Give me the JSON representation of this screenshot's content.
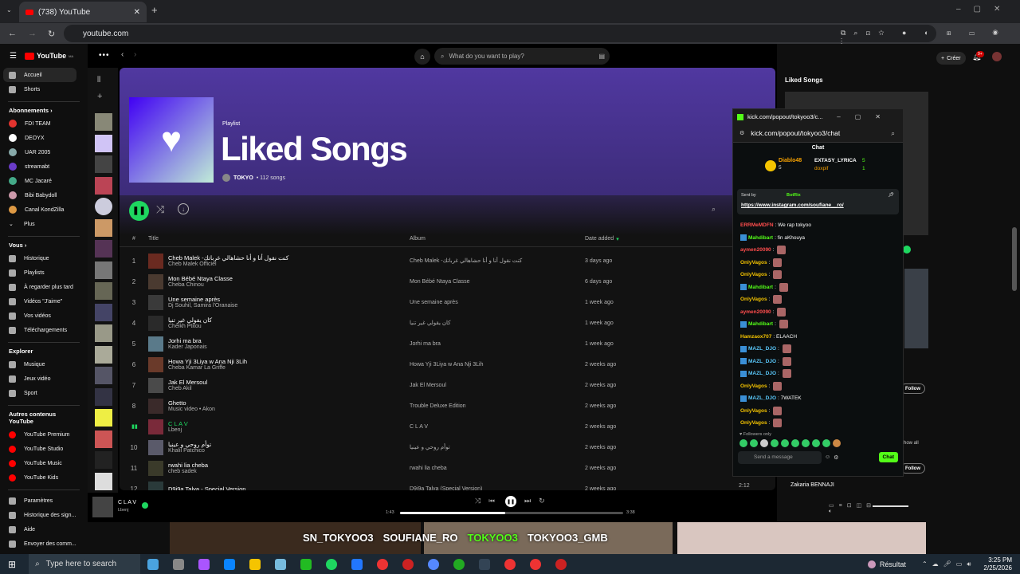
{
  "browser": {
    "tab_title": "(738) YouTube",
    "url": "youtube.com"
  },
  "youtube": {
    "logo": "YouTube",
    "country": "MA",
    "top": [
      "Accueil",
      "Shorts"
    ],
    "subs_title": "Abonnements",
    "subs": [
      "FDI TEAM",
      "DEOYX",
      "UAR 2005",
      "streamabt",
      "MC Jacaré",
      "Bibi Babydoll",
      "Canal KondZilla",
      "Plus"
    ],
    "you_title": "Vous",
    "you": [
      "Historique",
      "Playlists",
      "À regarder plus tard",
      "Vidéos \"J'aime\"",
      "Vos vidéos",
      "Téléchargements"
    ],
    "explore_title": "Explorer",
    "explore": [
      "Musique",
      "Jeux vidéo",
      "Sport"
    ],
    "other_title": "Autres contenus YouTube",
    "other": [
      "YouTube Premium",
      "YouTube Studio",
      "YouTube Music",
      "YouTube Kids"
    ],
    "bottom": [
      "Paramètres",
      "Historique des sign...",
      "Aide",
      "Envoyer des comm..."
    ],
    "create": "Créer",
    "notif": "9+",
    "right_title": "Liked Songs",
    "follow": "Follow",
    "see_all": "Show all",
    "artist": "Zakaria BENNAJI"
  },
  "spotify": {
    "search_placeholder": "What do you want to play?",
    "type": "Playlist",
    "title": "Liked Songs",
    "owner": "TOKYO",
    "meta": "• 112 songs",
    "headers": {
      "num": "#",
      "title": "Title",
      "album": "Album",
      "date": "Date added"
    },
    "tracks": [
      {
        "n": "1",
        "title": "Cheb Malek -كنت نقول أنا و أنا حشاهالي غرباتك",
        "artist": "Cheb Malek Officiel",
        "album": "Cheb Malek -كنت نقول أنا و أنا حشاهالي غرباتك",
        "date": "3 days ago"
      },
      {
        "n": "2",
        "title": "Mon Bébé Ntaya Classe",
        "artist": "Cheba Chinou",
        "album": "Mon Bébé Ntaya Classe",
        "date": "6 days ago"
      },
      {
        "n": "3",
        "title": "Une semaine après",
        "artist": "Dj Souhil, Samira l'Oranaise",
        "album": "Une semaine après",
        "date": "1 week ago"
      },
      {
        "n": "4",
        "title": "كان يقولي غير تنيا",
        "artist": "Cheikh Ptitou",
        "album": "كان يقولي غير تنيا",
        "date": "1 week ago"
      },
      {
        "n": "5",
        "title": "Jorhi ma bra",
        "artist": "Kader Japonais",
        "album": "Jorhi ma bra",
        "date": "1 week ago"
      },
      {
        "n": "6",
        "title": "Howa Yji 3Liya w Ana Nji 3Lih",
        "artist": "Cheba Kamar La Griffe",
        "album": "Howa Yji 3Liya w Ana Nji 3Lih",
        "date": "2 weeks ago"
      },
      {
        "n": "7",
        "title": "Jak El Mersoul",
        "artist": "Cheb Akil",
        "album": "Jak El Mersoul",
        "date": "2 weeks ago"
      },
      {
        "n": "8",
        "title": "Ghetto",
        "artist": "Music video • Akon",
        "album": "Trouble Deluxe Edition",
        "date": "2 weeks ago"
      },
      {
        "n": "",
        "title": "C L A V",
        "artist": "Lbenj",
        "album": "C L A V",
        "date": "2 weeks ago"
      },
      {
        "n": "10",
        "title": "توأم روحي و عينيا",
        "artist": "Khalil Patchico",
        "album": "توأم روحي و عينيا",
        "date": "2 weeks ago"
      },
      {
        "n": "11",
        "title": "rwahi lia cheba",
        "artist": "cheb sadek",
        "album": "rwahi lia cheba",
        "date": "2 weeks ago"
      },
      {
        "n": "12",
        "title": "D9i9a Talya - Special Version",
        "artist": "",
        "album": "D9i9a Talya (Special Version)",
        "date": "2 weeks ago"
      }
    ],
    "now_title": "C L A V",
    "now_artist": "Lbenj",
    "time_cur": "1:43",
    "time_total": "3:38",
    "progress": 0.47,
    "side_time": "2:12"
  },
  "kick": {
    "title": "kick.com/popout/tokyoo3/c...",
    "url": "kick.com/popout/tokyoo3/chat",
    "chat_label": "Chat",
    "gifters": [
      {
        "name": "Diablo48",
        "count": "5"
      },
      {
        "name": "EXTASY_LYRICA",
        "count": "5"
      },
      {
        "name": "doxpif",
        "count": "1"
      }
    ],
    "pinned_by": "Sent by",
    "pinned_user": "BotRix",
    "pinned_link": "https://www.instagram.com/soufiane__ro/",
    "messages": [
      {
        "user": "ERRMeMDFN",
        "text": ": We rap tokyoo",
        "color": "#ff4d4d"
      },
      {
        "user": "Mahdibart",
        "text": ": fin aKhouya",
        "color": "#53fc18"
      },
      {
        "user": "aymen20090",
        "text": ":",
        "color": "#ff4d4d"
      },
      {
        "user": "OnlyVagos",
        "text": ":",
        "color": "#f5c400"
      },
      {
        "user": "OnlyVagos",
        "text": ":",
        "color": "#f5c400"
      },
      {
        "user": "Mahdibart",
        "text": ":",
        "color": "#53fc18"
      },
      {
        "user": "OnlyVagos",
        "text": ":",
        "color": "#f5c400"
      },
      {
        "user": "aymen20090",
        "text": ":",
        "color": "#ff4d4d"
      },
      {
        "user": "Mahdibart",
        "text": ":",
        "color": "#53fc18"
      },
      {
        "user": "Hamzaox707",
        "text": ": ELAACH",
        "color": "#f5c400"
      },
      {
        "user": "MAZL_DJO",
        "text": ":",
        "color": "#5ac8fa"
      },
      {
        "user": "MAZL_DJO",
        "text": ":",
        "color": "#5ac8fa"
      },
      {
        "user": "MAZL_DJO",
        "text": ":",
        "color": "#5ac8fa"
      },
      {
        "user": "OnlyVagos",
        "text": ":",
        "color": "#f5c400"
      },
      {
        "user": "MAZL_DJO",
        "text": ": 7WATEK",
        "color": "#5ac8fa"
      },
      {
        "user": "OnlyVagos",
        "text": ":",
        "color": "#f5c400"
      },
      {
        "user": "OnlyVagos",
        "text": ":",
        "color": "#f5c400"
      }
    ],
    "followers_only": "Followers only",
    "input_placeholder": "Send a message",
    "send": "Chat"
  },
  "overlay": {
    "handles": [
      "SN_TOKYOO3",
      "SOUFIANE_RO",
      "TOKYOO3",
      "TOKYOO3_GMB"
    ]
  },
  "taskbar": {
    "search": "Type here to search",
    "weather": "Résultat",
    "time": "3:25 PM",
    "date": "2/25/2026"
  },
  "colors": {
    "spotify_green": "#1ed760",
    "kick_green": "#53fc18",
    "yt_red": "#ff0000"
  }
}
